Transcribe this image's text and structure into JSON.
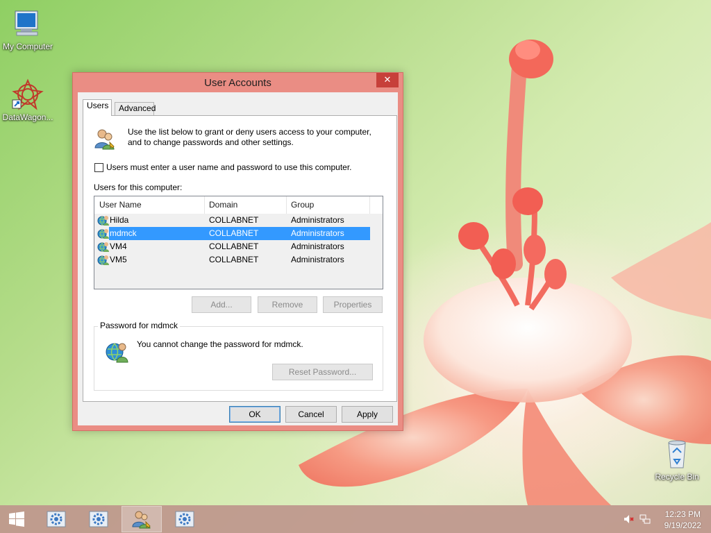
{
  "desktop": {
    "icons": [
      {
        "label": "My Computer",
        "icon": "computer-icon"
      },
      {
        "label": "DataWagon...",
        "icon": "datawagon-icon"
      },
      {
        "label": "Recycle Bin",
        "icon": "recycle-bin-icon"
      }
    ]
  },
  "dialog": {
    "title": "User Accounts",
    "close_label": "✕",
    "tabs": [
      {
        "label": "Users",
        "active": true
      },
      {
        "label": "Advanced",
        "active": false
      }
    ],
    "intro_text": "Use the list below to grant or deny users access to your computer, and to change passwords and other settings.",
    "checkbox": {
      "label": "Users must enter a user name and password to use this computer.",
      "checked": false
    },
    "users_label": "Users for this computer:",
    "columns": [
      "User Name",
      "Domain",
      "Group"
    ],
    "users": [
      {
        "name": "Hilda",
        "domain": "COLLABNET",
        "group": "Administrators",
        "selected": false
      },
      {
        "name": "mdmck",
        "domain": "COLLABNET",
        "group": "Administrators",
        "selected": true
      },
      {
        "name": "VM4",
        "domain": "COLLABNET",
        "group": "Administrators",
        "selected": false
      },
      {
        "name": "VM5",
        "domain": "COLLABNET",
        "group": "Administrators",
        "selected": false
      }
    ],
    "buttons": {
      "add": "Add...",
      "remove": "Remove",
      "properties": "Properties"
    },
    "password_group": {
      "title": "Password for mdmck",
      "message": "You cannot change the password for mdmck.",
      "reset_label": "Reset Password..."
    },
    "footer": {
      "ok": "OK",
      "cancel": "Cancel",
      "apply": "Apply"
    }
  },
  "taskbar": {
    "items": [
      {
        "icon": "settings-gear-icon",
        "active": false
      },
      {
        "icon": "settings-gear-icon",
        "active": false
      },
      {
        "icon": "user-accounts-icon",
        "active": true
      },
      {
        "icon": "settings-gear-icon",
        "active": false
      }
    ],
    "clock": {
      "time": "12:23 PM",
      "date": "9/19/2022"
    }
  },
  "colors": {
    "selection": "#3399ff",
    "titlebar": "#ea8d84",
    "close_button": "#c7403a"
  }
}
